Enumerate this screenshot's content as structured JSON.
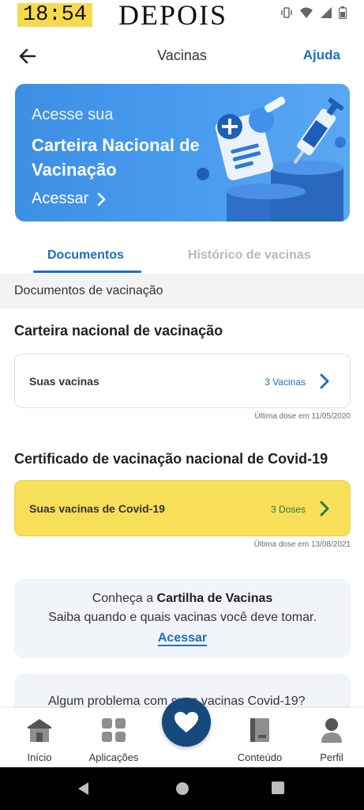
{
  "status_bar": {
    "time": "18:54",
    "overlay_label": "DEPOIS",
    "icons": [
      "vibrate-icon",
      "wifi-icon",
      "signal-icon",
      "battery-icon"
    ]
  },
  "header": {
    "title": "Vacinas",
    "help_label": "Ajuda"
  },
  "banner": {
    "line1": "Acesse sua",
    "line2": "Carteira Nacional de Vacinação",
    "cta": "Acessar"
  },
  "tabs": [
    {
      "label": "Documentos",
      "active": true
    },
    {
      "label": "Histórico de vacinas",
      "active": false
    }
  ],
  "section_label": "Documentos de vacinação",
  "groups": [
    {
      "title": "Carteira nacional de vacinação",
      "card_label": "Suas vacinas",
      "count": "3 Vacinas",
      "last_dose": "Última dose em 11/05/2020"
    },
    {
      "title": "Certificado de vacinação nacional de Covid-19",
      "card_label": "Suas vacinas de Covid-19",
      "count": "3 Doses",
      "last_dose": "Última dose em 13/08/2021"
    }
  ],
  "info": {
    "prefix": "Conheça a ",
    "highlight": "Cartilha de Vacinas",
    "line2": "Saiba quando e quais vacinas você deve tomar.",
    "link": "Acessar"
  },
  "problem_text": "Algum problema com suas vacinas Covid-19?",
  "bottom_nav": [
    {
      "label": "Início"
    },
    {
      "label": "Aplicações"
    },
    {
      "label": "Conteúdo"
    },
    {
      "label": "Perfil"
    }
  ],
  "colors": {
    "primary": "#1a6fc2",
    "banner": "#4a9cf0",
    "highlight": "#f7df5a",
    "fab": "#174a7c",
    "dose_green": "#2b7a3a"
  }
}
